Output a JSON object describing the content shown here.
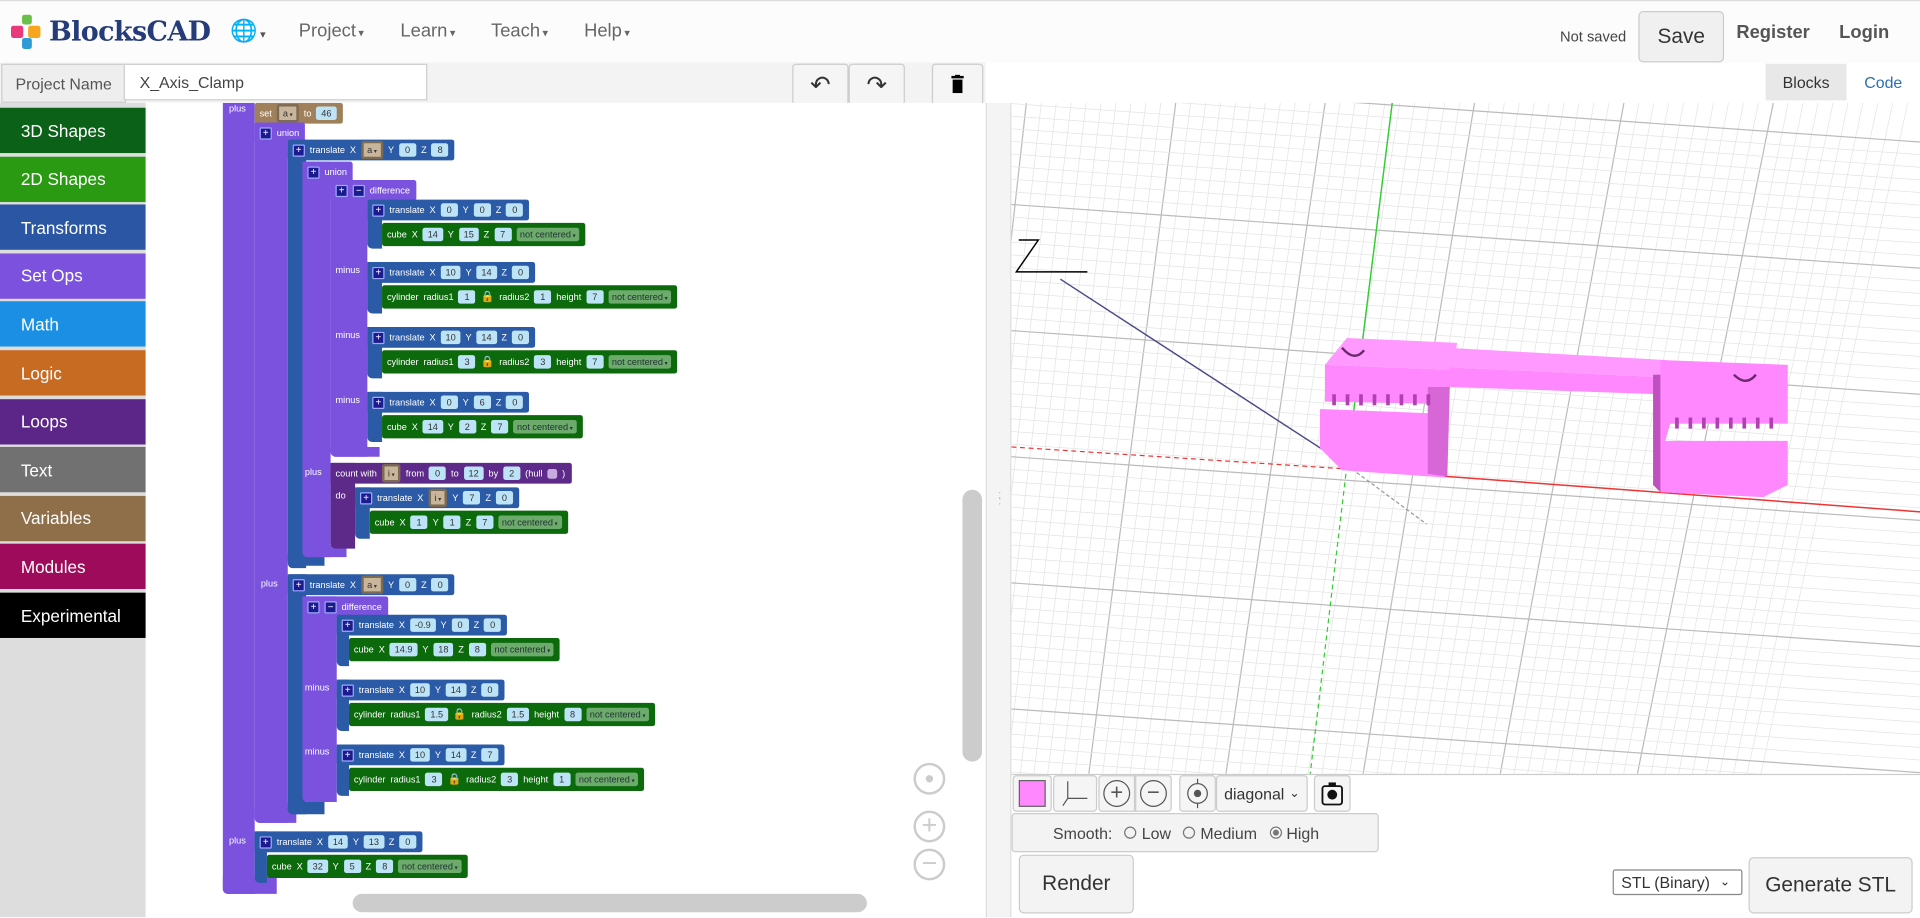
{
  "header": {
    "logo": "BlocksCAD",
    "globe_icon": "globe-icon",
    "nav": [
      "Project",
      "Learn",
      "Teach",
      "Help"
    ],
    "status": "Not saved",
    "save": "Save",
    "register": "Register",
    "login": "Login"
  },
  "project": {
    "label": "Project Name",
    "name": "X_Axis_Clamp",
    "undo_icon": "undo-icon",
    "redo_icon": "redo-icon",
    "trash_icon": "trash-icon"
  },
  "view_tabs": [
    "Blocks",
    "Code"
  ],
  "categories": [
    {
      "label": "3D Shapes",
      "color": "#0b6118"
    },
    {
      "label": "2D Shapes",
      "color": "#2a9a13"
    },
    {
      "label": "Transforms",
      "color": "#2b56a3"
    },
    {
      "label": "Set Ops",
      "color": "#7b51de"
    },
    {
      "label": "Math",
      "color": "#1a8fe3"
    },
    {
      "label": "Logic",
      "color": "#c76a22"
    },
    {
      "label": "Loops",
      "color": "#5c2689"
    },
    {
      "label": "Text",
      "color": "#717171"
    },
    {
      "label": "Variables",
      "color": "#8f6e4a"
    },
    {
      "label": "Modules",
      "color": "#9e0b5b"
    },
    {
      "label": "Experimental",
      "color": "#000000"
    }
  ],
  "side_labels": [
    "plus",
    "plus",
    "plus",
    "minus",
    "minus",
    "minus",
    "plus",
    "do",
    "minus",
    "minus"
  ],
  "blocks": [
    {
      "kind": "variables",
      "tokens": [
        [
          "l",
          "set"
        ],
        [
          "v",
          "a"
        ],
        [
          "l",
          "to"
        ],
        [
          "n",
          "46"
        ]
      ]
    },
    {
      "kind": "setops",
      "tokens": [
        [
          "b",
          "+"
        ],
        [
          "l",
          "union"
        ]
      ]
    },
    {
      "kind": "transforms",
      "tokens": [
        [
          "b",
          "+"
        ],
        [
          "l",
          "translate"
        ],
        [
          "l",
          "X"
        ],
        [
          "v",
          "a"
        ],
        [
          "l",
          "Y"
        ],
        [
          "n",
          "0"
        ],
        [
          "l",
          "Z"
        ],
        [
          "n",
          "8"
        ]
      ]
    },
    {
      "kind": "setops",
      "tokens": [
        [
          "b",
          "+"
        ],
        [
          "l",
          "union"
        ]
      ]
    },
    {
      "kind": "setops",
      "tokens": [
        [
          "b",
          "+"
        ],
        [
          "b",
          "−"
        ],
        [
          "l",
          "difference"
        ]
      ]
    },
    {
      "kind": "transforms",
      "tokens": [
        [
          "b",
          "+"
        ],
        [
          "l",
          "translate"
        ],
        [
          "l",
          "X"
        ],
        [
          "n",
          "0"
        ],
        [
          "l",
          "Y"
        ],
        [
          "n",
          "0"
        ],
        [
          "l",
          "Z"
        ],
        [
          "n",
          "0"
        ]
      ]
    },
    {
      "kind": "shapes",
      "tokens": [
        [
          "l",
          "cube"
        ],
        [
          "l",
          "X"
        ],
        [
          "n",
          "14"
        ],
        [
          "l",
          "Y"
        ],
        [
          "n",
          "15"
        ],
        [
          "l",
          "Z"
        ],
        [
          "n",
          "7"
        ],
        [
          "d",
          "not centered"
        ]
      ]
    },
    {
      "kind": "transforms",
      "tokens": [
        [
          "b",
          "+"
        ],
        [
          "l",
          "translate"
        ],
        [
          "l",
          "X"
        ],
        [
          "n",
          "10"
        ],
        [
          "l",
          "Y"
        ],
        [
          "n",
          "14"
        ],
        [
          "l",
          "Z"
        ],
        [
          "n",
          "0"
        ]
      ]
    },
    {
      "kind": "shapes",
      "tokens": [
        [
          "l",
          "cylinder"
        ],
        [
          "l",
          "radius1"
        ],
        [
          "n",
          "1"
        ],
        [
          "k",
          "lock"
        ],
        [
          "l",
          "radius2"
        ],
        [
          "n",
          "1"
        ],
        [
          "l",
          "height"
        ],
        [
          "n",
          "7"
        ],
        [
          "d",
          "not centered"
        ]
      ]
    },
    {
      "kind": "transforms",
      "tokens": [
        [
          "b",
          "+"
        ],
        [
          "l",
          "translate"
        ],
        [
          "l",
          "X"
        ],
        [
          "n",
          "10"
        ],
        [
          "l",
          "Y"
        ],
        [
          "n",
          "14"
        ],
        [
          "l",
          "Z"
        ],
        [
          "n",
          "0"
        ]
      ]
    },
    {
      "kind": "shapes",
      "tokens": [
        [
          "l",
          "cylinder"
        ],
        [
          "l",
          "radius1"
        ],
        [
          "n",
          "3"
        ],
        [
          "k",
          "lock"
        ],
        [
          "l",
          "radius2"
        ],
        [
          "n",
          "3"
        ],
        [
          "l",
          "height"
        ],
        [
          "n",
          "7"
        ],
        [
          "d",
          "not centered"
        ]
      ]
    },
    {
      "kind": "transforms",
      "tokens": [
        [
          "b",
          "+"
        ],
        [
          "l",
          "translate"
        ],
        [
          "l",
          "X"
        ],
        [
          "n",
          "0"
        ],
        [
          "l",
          "Y"
        ],
        [
          "n",
          "6"
        ],
        [
          "l",
          "Z"
        ],
        [
          "n",
          "0"
        ]
      ]
    },
    {
      "kind": "shapes",
      "tokens": [
        [
          "l",
          "cube"
        ],
        [
          "l",
          "X"
        ],
        [
          "n",
          "14"
        ],
        [
          "l",
          "Y"
        ],
        [
          "n",
          "2"
        ],
        [
          "l",
          "Z"
        ],
        [
          "n",
          "7"
        ],
        [
          "d",
          "not centered"
        ]
      ]
    },
    {
      "kind": "loops",
      "tokens": [
        [
          "l",
          "count with"
        ],
        [
          "v",
          "i"
        ],
        [
          "l",
          "from"
        ],
        [
          "n",
          "0"
        ],
        [
          "l",
          "to"
        ],
        [
          "n",
          "12"
        ],
        [
          "l",
          "by"
        ],
        [
          "n",
          "2"
        ],
        [
          "l",
          "(hull"
        ],
        [
          "c",
          "unchecked"
        ],
        [
          "l",
          ")"
        ]
      ]
    },
    {
      "kind": "transforms",
      "tokens": [
        [
          "b",
          "+"
        ],
        [
          "l",
          "translate"
        ],
        [
          "l",
          "X"
        ],
        [
          "v",
          "i"
        ],
        [
          "l",
          "Y"
        ],
        [
          "n",
          "7"
        ],
        [
          "l",
          "Z"
        ],
        [
          "n",
          "0"
        ]
      ]
    },
    {
      "kind": "shapes",
      "tokens": [
        [
          "l",
          "cube"
        ],
        [
          "l",
          "X"
        ],
        [
          "n",
          "1"
        ],
        [
          "l",
          "Y"
        ],
        [
          "n",
          "1"
        ],
        [
          "l",
          "Z"
        ],
        [
          "n",
          "7"
        ],
        [
          "d",
          "not centered"
        ]
      ]
    },
    {
      "kind": "transforms",
      "tokens": [
        [
          "b",
          "+"
        ],
        [
          "l",
          "translate"
        ],
        [
          "l",
          "X"
        ],
        [
          "v",
          "a"
        ],
        [
          "l",
          "Y"
        ],
        [
          "n",
          "0"
        ],
        [
          "l",
          "Z"
        ],
        [
          "n",
          "0"
        ]
      ]
    },
    {
      "kind": "setops",
      "tokens": [
        [
          "b",
          "+"
        ],
        [
          "b",
          "−"
        ],
        [
          "l",
          "difference"
        ]
      ]
    },
    {
      "kind": "transforms",
      "tokens": [
        [
          "b",
          "+"
        ],
        [
          "l",
          "translate"
        ],
        [
          "l",
          "X"
        ],
        [
          "n",
          "-0.9"
        ],
        [
          "l",
          "Y"
        ],
        [
          "n",
          "0"
        ],
        [
          "l",
          "Z"
        ],
        [
          "n",
          "0"
        ]
      ]
    },
    {
      "kind": "shapes",
      "tokens": [
        [
          "l",
          "cube"
        ],
        [
          "l",
          "X"
        ],
        [
          "n",
          "14.9"
        ],
        [
          "l",
          "Y"
        ],
        [
          "n",
          "18"
        ],
        [
          "l",
          "Z"
        ],
        [
          "n",
          "8"
        ],
        [
          "d",
          "not centered"
        ]
      ]
    },
    {
      "kind": "transforms",
      "tokens": [
        [
          "b",
          "+"
        ],
        [
          "l",
          "translate"
        ],
        [
          "l",
          "X"
        ],
        [
          "n",
          "10"
        ],
        [
          "l",
          "Y"
        ],
        [
          "n",
          "14"
        ],
        [
          "l",
          "Z"
        ],
        [
          "n",
          "0"
        ]
      ]
    },
    {
      "kind": "shapes",
      "tokens": [
        [
          "l",
          "cylinder"
        ],
        [
          "l",
          "radius1"
        ],
        [
          "n",
          "1.5"
        ],
        [
          "k",
          "lock"
        ],
        [
          "l",
          "radius2"
        ],
        [
          "n",
          "1.5"
        ],
        [
          "l",
          "height"
        ],
        [
          "n",
          "8"
        ],
        [
          "d",
          "not centered"
        ]
      ]
    },
    {
      "kind": "transforms",
      "tokens": [
        [
          "b",
          "+"
        ],
        [
          "l",
          "translate"
        ],
        [
          "l",
          "X"
        ],
        [
          "n",
          "10"
        ],
        [
          "l",
          "Y"
        ],
        [
          "n",
          "14"
        ],
        [
          "l",
          "Z"
        ],
        [
          "n",
          "7"
        ]
      ]
    },
    {
      "kind": "shapes",
      "tokens": [
        [
          "l",
          "cylinder"
        ],
        [
          "l",
          "radius1"
        ],
        [
          "n",
          "3"
        ],
        [
          "k",
          "lock"
        ],
        [
          "l",
          "radius2"
        ],
        [
          "n",
          "3"
        ],
        [
          "l",
          "height"
        ],
        [
          "n",
          "1"
        ],
        [
          "d",
          "not centered"
        ]
      ]
    },
    {
      "kind": "transforms",
      "tokens": [
        [
          "b",
          "+"
        ],
        [
          "l",
          "translate"
        ],
        [
          "l",
          "X"
        ],
        [
          "n",
          "14"
        ],
        [
          "l",
          "Y"
        ],
        [
          "n",
          "13"
        ],
        [
          "l",
          "Z"
        ],
        [
          "n",
          "0"
        ]
      ]
    },
    {
      "kind": "shapes",
      "tokens": [
        [
          "l",
          "cube"
        ],
        [
          "l",
          "X"
        ],
        [
          "n",
          "32"
        ],
        [
          "l",
          "Y"
        ],
        [
          "n",
          "5"
        ],
        [
          "l",
          "Z"
        ],
        [
          "n",
          "8"
        ],
        [
          "d",
          "not centered"
        ]
      ]
    }
  ],
  "viewer": {
    "object_color": "#ff88ff",
    "view": "diagonal",
    "smooth_label": "Smooth:",
    "smooth_options": [
      "Low",
      "Medium",
      "High"
    ],
    "smooth_selected": "High",
    "render": "Render",
    "format": "STL (Binary)",
    "generate": "Generate STL"
  }
}
